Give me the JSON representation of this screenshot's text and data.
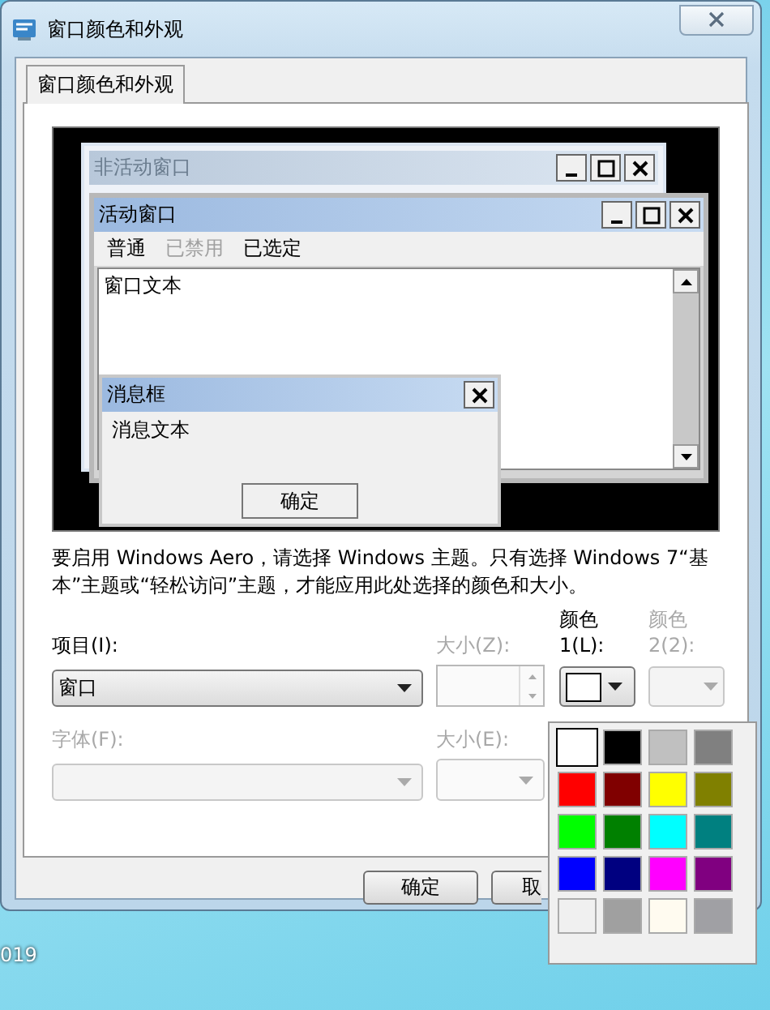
{
  "window": {
    "title": "窗口颜色和外观"
  },
  "tabs": [
    {
      "label": "窗口颜色和外观",
      "selected": true
    }
  ],
  "preview": {
    "inactive_window": {
      "title": "非活动窗口"
    },
    "active_window": {
      "title": "活动窗口",
      "menu": [
        {
          "label": "普通",
          "disabled": false
        },
        {
          "label": "已禁用",
          "disabled": true
        },
        {
          "label": "已选定",
          "disabled": false
        }
      ],
      "text": "窗口文本"
    },
    "message_box": {
      "title": "消息框",
      "text": "消息文本",
      "button": "确定"
    }
  },
  "note": "要启用 Windows Aero，请选择 Windows 主题。只有选择 Windows 7“基本”主题或“轻松访问”主题，才能应用此处选择的颜色和大小。",
  "item": {
    "label": "项目(I):",
    "value": "窗口",
    "disabled": false
  },
  "size": {
    "label": "大小(Z):",
    "disabled": true
  },
  "color1": {
    "label": "颜色 1(L):",
    "color": "#ffffff",
    "disabled": false
  },
  "color2": {
    "label": "颜色 2(2):",
    "disabled": true
  },
  "font": {
    "label": "字体(F):",
    "disabled": true
  },
  "font_size": {
    "label": "大小(E):",
    "disabled": true
  },
  "buttons": [
    {
      "label": "确定"
    },
    {
      "label": "取"
    }
  ],
  "palette": [
    {
      "color": "#ffffff",
      "selected": true
    },
    {
      "color": "#000000",
      "selected": false
    },
    {
      "color": "#c0c0c0",
      "selected": false
    },
    {
      "color": "#808080",
      "selected": false
    },
    {
      "color": "#ff0000",
      "selected": false
    },
    {
      "color": "#800000",
      "selected": false
    },
    {
      "color": "#ffff00",
      "selected": false
    },
    {
      "color": "#808000",
      "selected": false
    },
    {
      "color": "#00ff00",
      "selected": false
    },
    {
      "color": "#008000",
      "selected": false
    },
    {
      "color": "#00ffff",
      "selected": false
    },
    {
      "color": "#008080",
      "selected": false
    },
    {
      "color": "#0000ff",
      "selected": false
    },
    {
      "color": "#000080",
      "selected": false
    },
    {
      "color": "#ff00ff",
      "selected": false
    },
    {
      "color": "#800080",
      "selected": false
    },
    {
      "color": "#f0f0f0",
      "selected": false
    },
    {
      "color": "#a0a0a0",
      "selected": false
    },
    {
      "color": "#fffbf0",
      "selected": false
    },
    {
      "color": "#a0a0a4",
      "selected": false
    }
  ],
  "desktop": {
    "icon_label": "019"
  }
}
